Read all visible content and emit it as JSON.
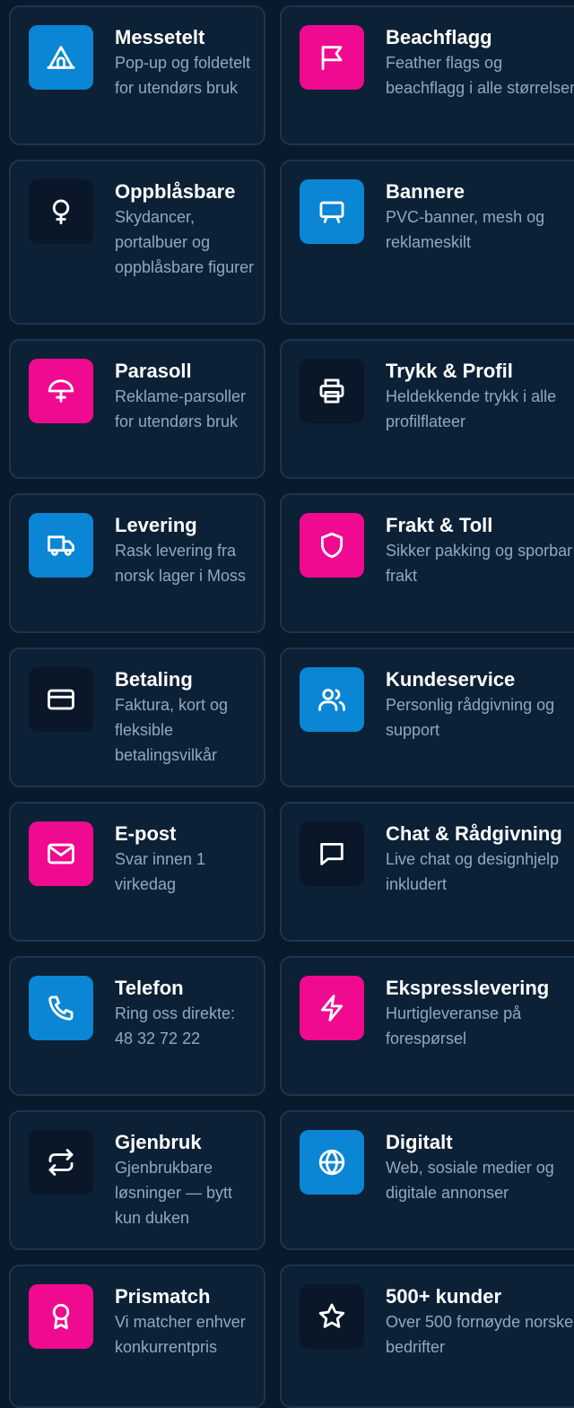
{
  "cards": [
    {
      "title": "Messetelt",
      "desc": "Pop-up og foldetelt for utendørs bruk",
      "icon": "tent-icon",
      "color": "#0a86d4"
    },
    {
      "title": "Beachflagg",
      "desc": "Feather flags og beachflagg i alle størrelser",
      "icon": "flag-icon",
      "color": "#f00a90"
    },
    {
      "title": "Oppblåsbare",
      "desc": "Skydancer, portalbuer og oppblåsbare figurer",
      "icon": "balloon-icon",
      "color": "#091729"
    },
    {
      "title": "Bannere",
      "desc": "PVC-banner, mesh og reklameskilt",
      "icon": "billboard-icon",
      "color": "#0a86d4"
    },
    {
      "title": "Parasoll",
      "desc": "Reklame-parsoller for utendørs bruk",
      "icon": "umbrella-icon",
      "color": "#f00a90"
    },
    {
      "title": "Trykk & Profil",
      "desc": "Heldekkende trykk i alle profilflateer",
      "icon": "printer-icon",
      "color": "#091729"
    },
    {
      "title": "Levering",
      "desc": "Rask levering fra norsk lager i Moss",
      "icon": "truck-icon",
      "color": "#0a86d4"
    },
    {
      "title": "Frakt & Toll",
      "desc": "Sikker pakking og sporbar frakt",
      "icon": "shield-icon",
      "color": "#f00a90"
    },
    {
      "title": "Betaling",
      "desc": "Faktura, kort og fleksible betalingsvilkår",
      "icon": "credit-card-icon",
      "color": "#091729"
    },
    {
      "title": "Kundeservice",
      "desc": "Personlig rådgivning og support",
      "icon": "users-icon",
      "color": "#0a86d4"
    },
    {
      "title": "E-post",
      "desc": "Svar innen 1 virkedag",
      "icon": "mail-icon",
      "color": "#f00a90"
    },
    {
      "title": "Chat & Rådgivning",
      "desc": "Live chat og designhjelp inkludert",
      "icon": "chat-icon",
      "color": "#091729"
    },
    {
      "title": "Telefon",
      "desc": "Ring oss direkte: 48 32 72 22",
      "icon": "phone-icon",
      "color": "#0a86d4"
    },
    {
      "title": "Ekspresslevering",
      "desc": "Hurtigleveranse på forespørsel",
      "icon": "lightning-icon",
      "color": "#f00a90"
    },
    {
      "title": "Gjenbruk",
      "desc": "Gjenbrukbare løsninger — bytt kun duken",
      "icon": "repeat-icon",
      "color": "#091729"
    },
    {
      "title": "Digitalt",
      "desc": "Web, sosiale medier og digitale annonser",
      "icon": "globe-icon",
      "color": "#0a86d4"
    },
    {
      "title": "Prismatch",
      "desc": "Vi matcher enhver konkurrentpris",
      "icon": "award-icon",
      "color": "#f00a90"
    },
    {
      "title": "500+ kunder",
      "desc": "Over 500 fornøyde norske bedrifter",
      "icon": "star-icon",
      "color": "#091729"
    }
  ]
}
